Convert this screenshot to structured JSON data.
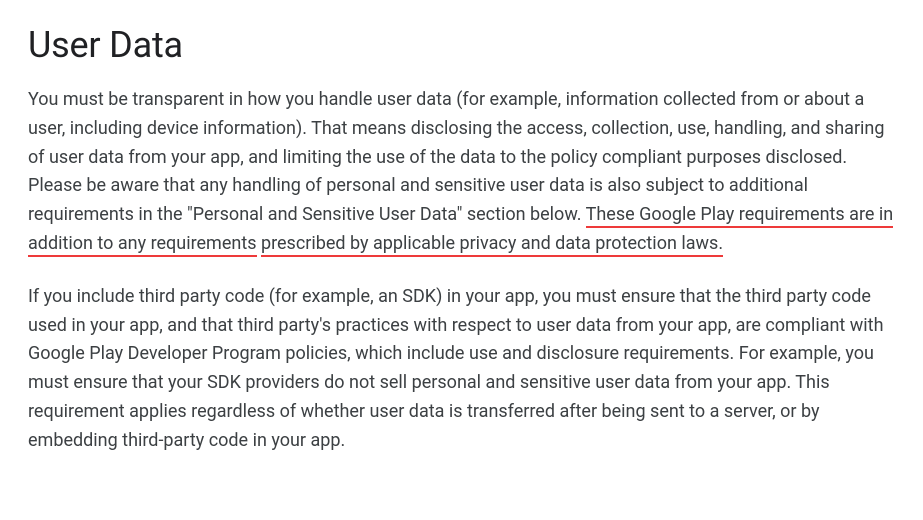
{
  "heading": "User Data",
  "para1_part1": "You must be transparent in how you handle user data (for example, information collected from or about a user, including device information). That means disclosing the access, collection, use, handling, and sharing of user data from your app, and limiting the use of the data to the policy compliant purposes disclosed. Please be aware that any handling of personal and sensitive user data is also subject to additional requirements in the \"Personal and Sensitive User Data\" section below. ",
  "para1_underlined1": "These Google Play requirements are in addition to any requirements",
  "para1_space": " ",
  "para1_underlined2": "prescribed by applicable privacy and data protection laws.",
  "para2": "If you include third party code (for example, an SDK) in your app, you must ensure that the third party code used in your app, and that third party's practices with respect to user data from your app, are compliant with Google Play Developer Program policies, which include use and disclosure requirements. For example, you must ensure that your SDK providers do not sell personal and sensitive user data from your app. This requirement applies regardless of whether user data is transferred after being sent to a server, or by embedding third-party code in your app."
}
